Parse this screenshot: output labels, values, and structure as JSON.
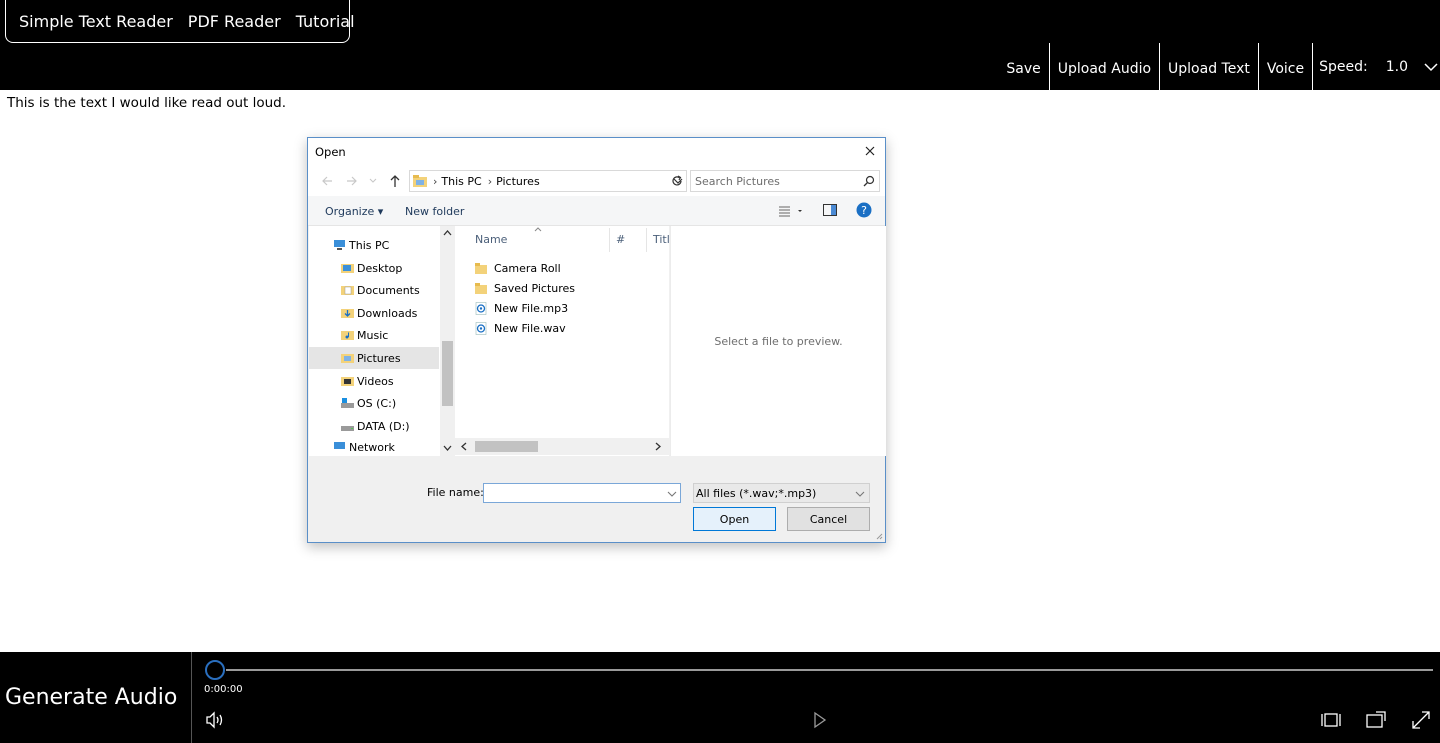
{
  "top_tabs": [
    "Simple Text Reader",
    "PDF Reader",
    "Tutorial"
  ],
  "toolbar": {
    "save": "Save",
    "upload_audio": "Upload Audio",
    "upload_text": "Upload Text",
    "voice": "Voice",
    "speed_label": "Speed:",
    "speed_value": "1.0"
  },
  "content": {
    "text": "This is the text I would like read out loud."
  },
  "dialog": {
    "title": "Open",
    "address": [
      "This PC",
      "Pictures"
    ],
    "search_placeholder": "Search Pictures",
    "commands": {
      "organize": "Organize",
      "new_folder": "New folder"
    },
    "nav_items": [
      {
        "label": "This PC",
        "icon": "pc-icon"
      },
      {
        "label": "Desktop",
        "icon": "folder-icon"
      },
      {
        "label": "Documents",
        "icon": "folder-icon"
      },
      {
        "label": "Downloads",
        "icon": "folder-icon"
      },
      {
        "label": "Music",
        "icon": "folder-icon"
      },
      {
        "label": "Pictures",
        "icon": "folder-icon",
        "selected": true
      },
      {
        "label": "Videos",
        "icon": "folder-icon"
      },
      {
        "label": "OS (C:)",
        "icon": "drive-icon"
      },
      {
        "label": "DATA (D:)",
        "icon": "drive-icon"
      },
      {
        "label": "Network",
        "icon": "network-icon"
      }
    ],
    "columns": [
      "Name",
      "#",
      "Titl"
    ],
    "files": [
      {
        "name": "Camera Roll",
        "icon": "folder-icon"
      },
      {
        "name": "Saved Pictures",
        "icon": "folder-icon"
      },
      {
        "name": "New File.mp3",
        "icon": "audio-file-icon"
      },
      {
        "name": "New File.wav",
        "icon": "audio-file-icon"
      }
    ],
    "preview_text": "Select a file to preview.",
    "file_name_label": "File name:",
    "file_name_value": "",
    "file_type": "All files (*.wav;*.mp3)",
    "open_button": "Open",
    "cancel_button": "Cancel"
  },
  "player": {
    "generate_label": "Generate Audio",
    "time": "0:00:00",
    "progress": 0
  },
  "colors": {
    "bar_background": "#000000",
    "accent_blue": "#0078d7",
    "seek_knob_border": "#2a6fbf"
  }
}
